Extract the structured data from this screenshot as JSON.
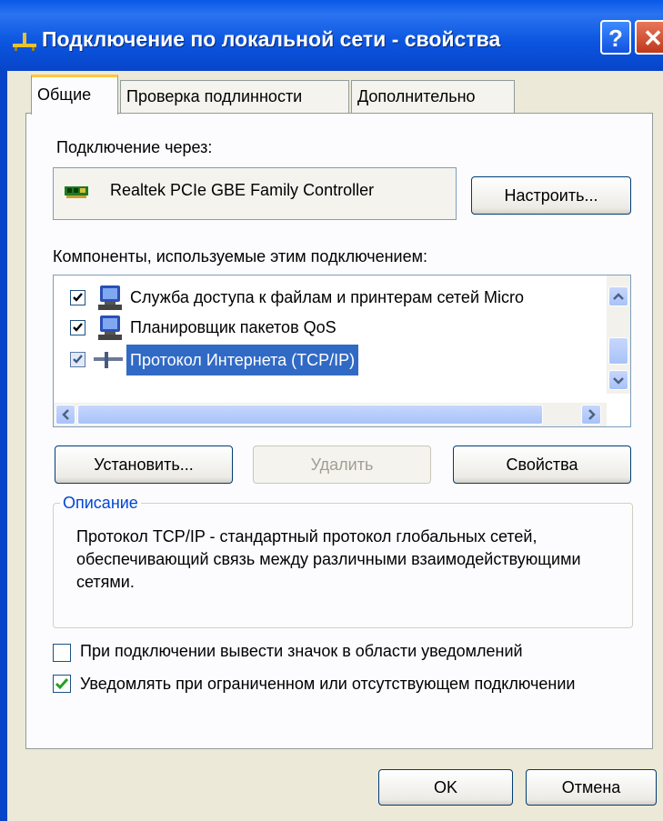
{
  "window": {
    "title": "Подключение по локальной сети - свойства",
    "help_label": "?",
    "close_label": "✕"
  },
  "tabs": [
    {
      "label": "Общие",
      "active": true
    },
    {
      "label": "Проверка подлинности",
      "active": false
    },
    {
      "label": "Дополнительно",
      "active": false
    }
  ],
  "connect_via": {
    "label": "Подключение через:",
    "adapter": "Realtek PCIe GBE Family Controller",
    "configure_button": "Настроить..."
  },
  "components": {
    "label": "Компоненты, используемые этим подключением:",
    "items": [
      {
        "label": "Служба доступа к файлам и принтерам сетей Micro",
        "checked": true,
        "icon": "network-service-icon",
        "selected": false
      },
      {
        "label": "Планировщик пакетов QoS",
        "checked": true,
        "icon": "network-service-icon",
        "selected": false
      },
      {
        "label": "Протокол Интернета (TCP/IP)",
        "checked": true,
        "icon": "protocol-icon",
        "selected": true
      }
    ]
  },
  "buttons": {
    "install": "Установить...",
    "remove": "Удалить",
    "properties": "Свойства",
    "ok": "OK",
    "cancel": "Отмена"
  },
  "description": {
    "legend": "Описание",
    "text": "Протокол TCP/IP - стандартный протокол глобальных сетей, обеспечивающий связь между различными взаимодействующими сетями."
  },
  "options": [
    {
      "label": "При подключении вывести значок в области уведомлений",
      "checked": false
    },
    {
      "label": "Уведомлять при ограниченном или отсутствующем подключении",
      "checked": true
    }
  ],
  "colors": {
    "titlebar": "#0A58E8",
    "selection": "#316AC5",
    "legend_text": "#0046D5",
    "check_green": "#21A121"
  }
}
